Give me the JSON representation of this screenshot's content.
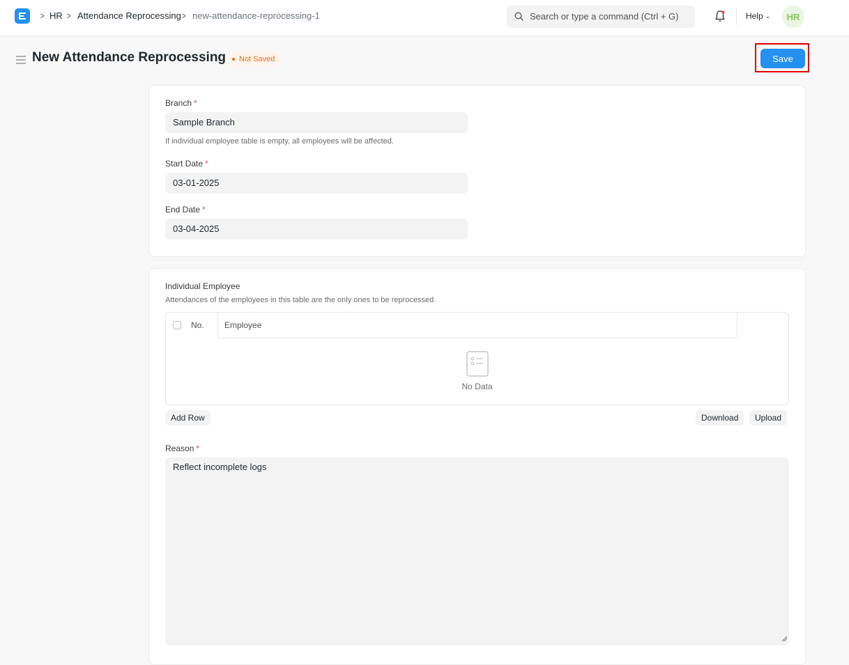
{
  "navbar": {
    "breadcrumbs": [
      "HR",
      "Attendance Reprocessing",
      "new-attendance-reprocessing-1"
    ],
    "search_placeholder": "Search or type a command (Ctrl + G)",
    "help_label": "Help",
    "avatar_initials": "HR"
  },
  "page": {
    "title": "New Attendance Reprocessing",
    "status_indicator": "Not Saved",
    "save_label": "Save"
  },
  "form": {
    "branch": {
      "label": "Branch",
      "required_mark": "*",
      "value": "Sample Branch",
      "description": "If individual employee table is empty, all employees will be affected."
    },
    "start_date": {
      "label": "Start Date",
      "required_mark": "*",
      "value": "03-01-2025"
    },
    "end_date": {
      "label": "End Date",
      "required_mark": "*",
      "value": "03-04-2025"
    },
    "individual_employee": {
      "label": "Individual Employee",
      "description": "Attendances of the employees in this table are the only ones to be reprocessed.",
      "columns": [
        "No.",
        "Employee"
      ],
      "empty_text": "No Data",
      "add_row_label": "Add Row",
      "download_label": "Download",
      "upload_label": "Upload"
    },
    "reason": {
      "label": "Reason",
      "required_mark": "*",
      "value": "Reflect incomplete logs"
    }
  },
  "colors": {
    "primary": "#2490ef",
    "not_saved": "#e86c13",
    "required": "#e24c4c",
    "highlight": "#e10000"
  }
}
